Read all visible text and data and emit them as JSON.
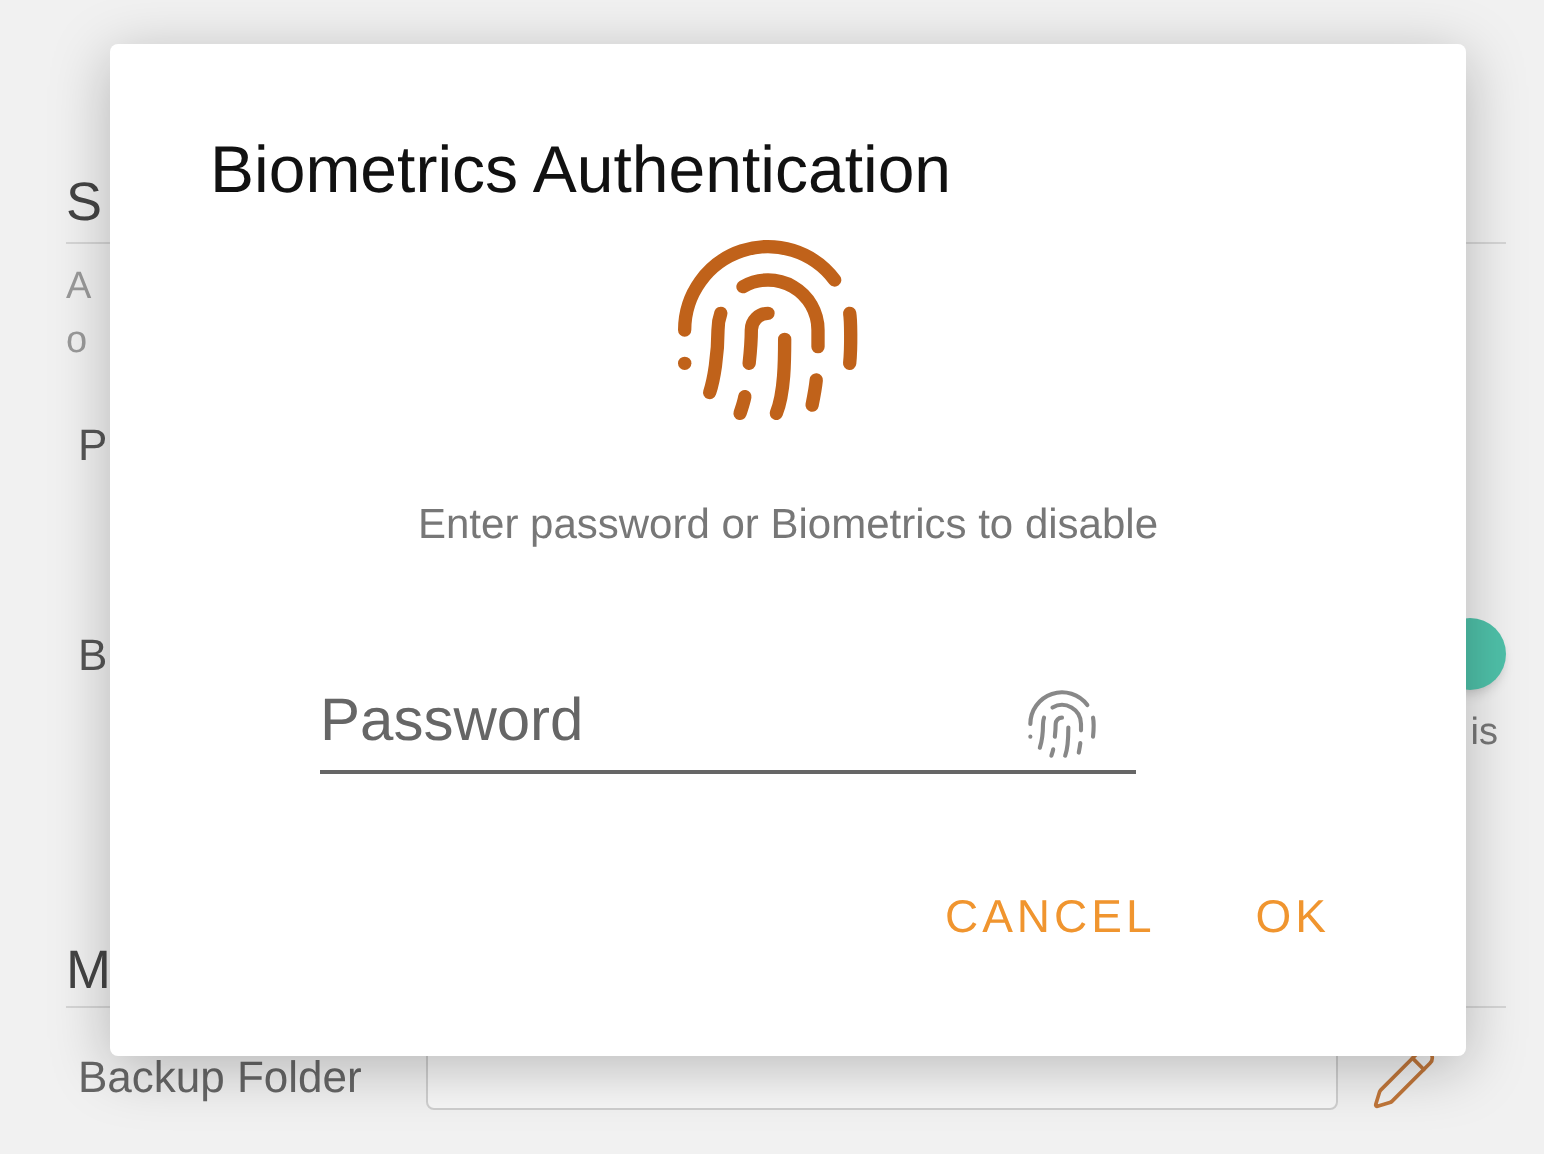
{
  "background": {
    "section_header": "S",
    "description_lines": [
      "A",
      "o"
    ],
    "setting_1": "P",
    "setting_2": "B",
    "toggle": {
      "on": true
    },
    "setting_2_note": "is",
    "section_header_2": "M",
    "backup_folder": {
      "label": "Backup Folder"
    }
  },
  "dialog": {
    "title": "Biometrics Authentication",
    "message": "Enter password or Biometrics to disable",
    "password": {
      "placeholder": "Password"
    },
    "buttons": [
      "CANCEL",
      "OK"
    ]
  }
}
